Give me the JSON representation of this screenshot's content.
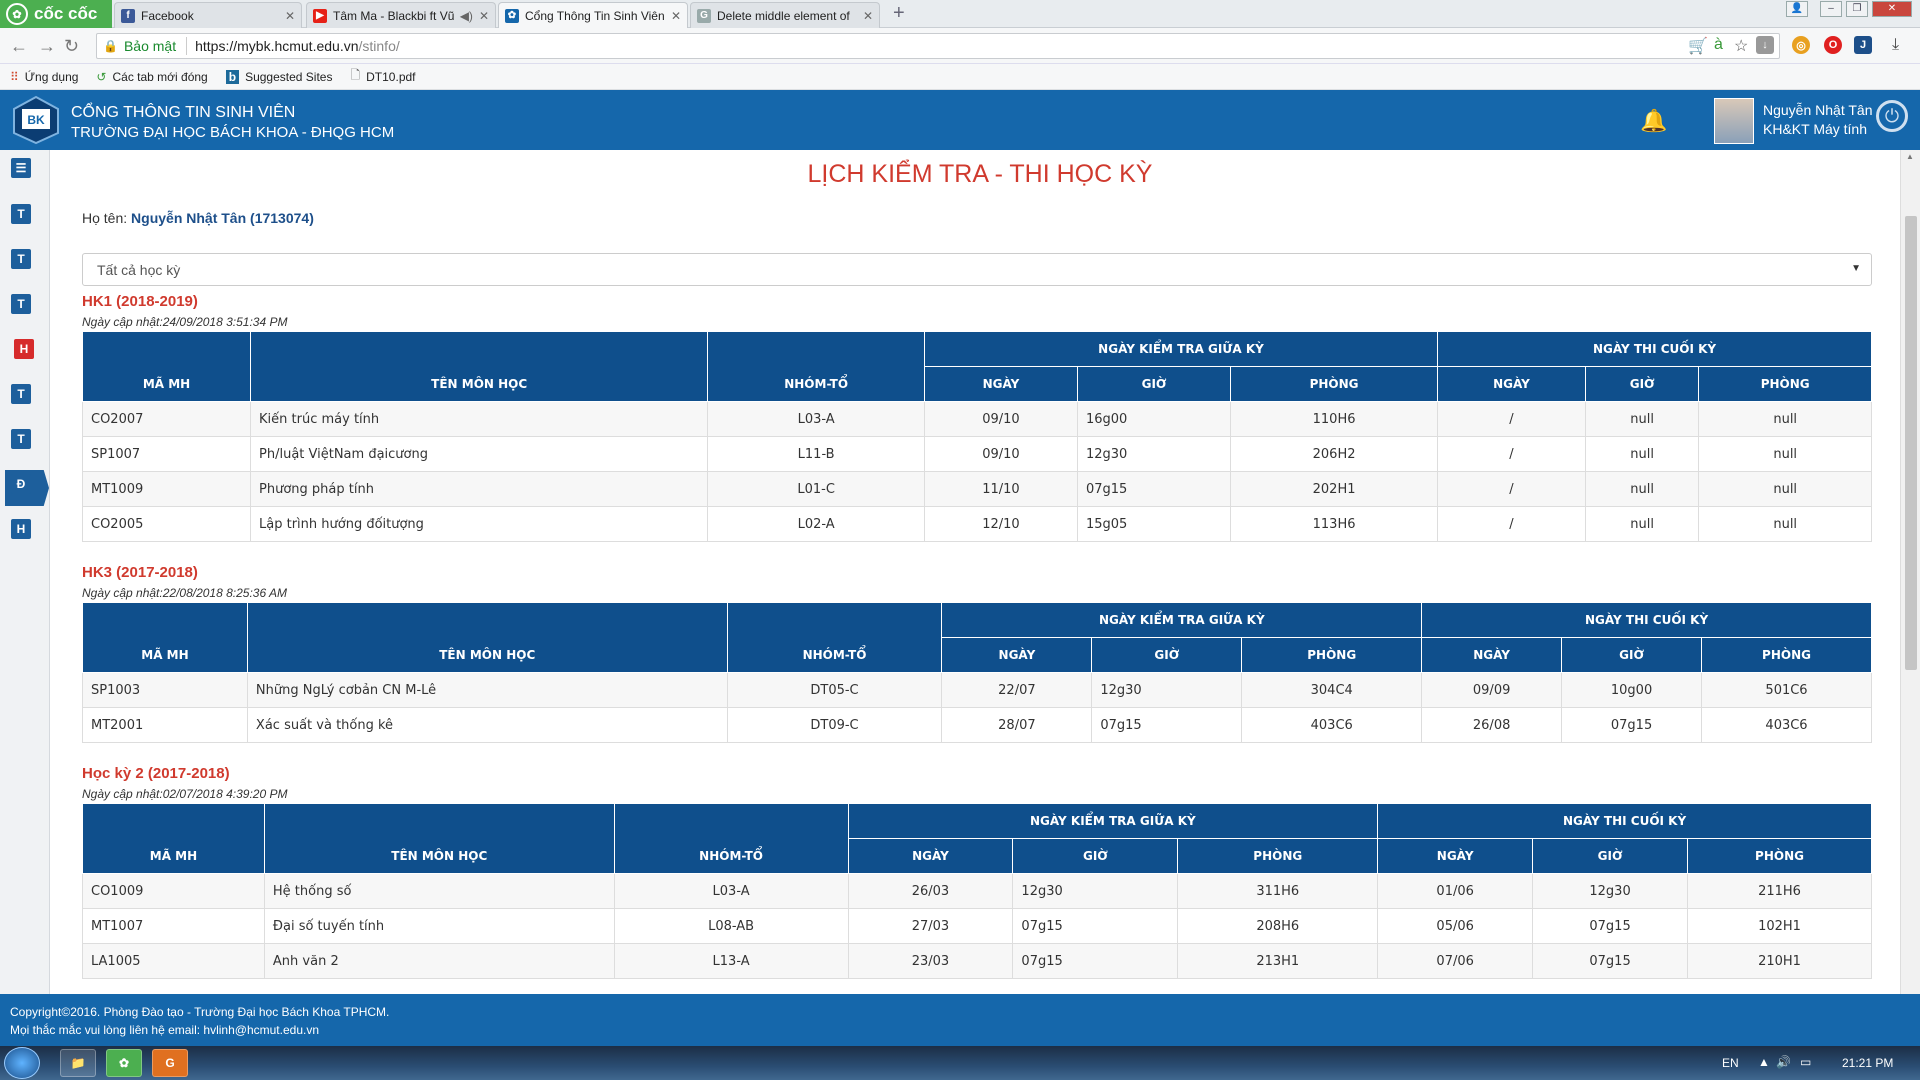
{
  "browser": {
    "brand": "cốc cốc",
    "tabs": [
      {
        "label": "Facebook",
        "icon": "facebook-icon",
        "color": "#3b5998",
        "glyph": "f"
      },
      {
        "label": "Tâm Ma - Blackbi ft Vũ",
        "icon": "youtube-icon",
        "color": "#e62117",
        "glyph": "▶"
      },
      {
        "label": "Cổng Thông Tin Sinh Viên",
        "icon": "bk-icon",
        "color": "#1567ab",
        "glyph": "✿"
      },
      {
        "label": "Delete middle element of",
        "icon": "page-icon",
        "color": "#9aa",
        "glyph": "G"
      }
    ],
    "secure_label": "Bảo mật",
    "url_host": "https://mybk.hcmut.edu.vn",
    "url_path": "/stinfo/",
    "bookmarks": [
      {
        "label": "Ứng dụng",
        "icon": "apps-grid-icon"
      },
      {
        "label": "Các tab mới đóng",
        "icon": "history-icon"
      },
      {
        "label": "Suggested Sites",
        "icon": "bing-icon"
      },
      {
        "label": "DT10.pdf",
        "icon": "file-icon"
      }
    ]
  },
  "header": {
    "title1": "CỔNG THÔNG TIN SINH VIÊN",
    "title2": "TRƯỜNG ĐẠI HỌC BÁCH KHOA - ĐHQG HCM",
    "logo_text": "BK",
    "user_name": "Nguyễn Nhật Tân",
    "user_major": "KH&KT Máy tính"
  },
  "sidebar": {
    "items": [
      "T",
      "T",
      "T",
      "H",
      "T",
      "T",
      "Đ",
      "H"
    ],
    "active_index": 3
  },
  "page": {
    "title": "LỊCH KIỂM TRA - THI HỌC KỲ",
    "student_label": "Họ tên:",
    "student_value": "Nguyễn Nhật Tân (1713074)",
    "semester_select": "Tất cả học kỳ"
  },
  "table_headers": {
    "code": "MÃ MH",
    "name": "TÊN MÔN HỌC",
    "group": "NHÓM-TỔ",
    "midterm": "NGÀY KIỂM TRA GIỮA KỲ",
    "final": "NGÀY THI CUỐI KỲ",
    "date": "NGÀY",
    "time": "GIỜ",
    "room": "PHÒNG"
  },
  "sections": [
    {
      "title": "HK1 (2018-2019)",
      "updated": "Ngày cập nhật:24/09/2018 3:51:34 PM",
      "rows": [
        [
          "CO2007",
          "Kiến trúc máy tính",
          "L03-A",
          "09/10",
          "16g00",
          "110H6",
          "/",
          "null",
          "null"
        ],
        [
          "SP1007",
          "Ph/luật ViệtNam đạicương",
          "L11-B",
          "09/10",
          "12g30",
          "206H2",
          "/",
          "null",
          "null"
        ],
        [
          "MT1009",
          "Phương pháp tính",
          "L01-C",
          "11/10",
          "07g15",
          "202H1",
          "/",
          "null",
          "null"
        ],
        [
          "CO2005",
          "Lập trình hướng đốitượng",
          "L02-A",
          "12/10",
          "15g05",
          "113H6",
          "/",
          "null",
          "null"
        ]
      ]
    },
    {
      "title": "HK3 (2017-2018)",
      "updated": "Ngày cập nhật:22/08/2018 8:25:36 AM",
      "rows": [
        [
          "SP1003",
          "Những NgLý cơbản CN M-Lê",
          "DT05-C",
          "22/07",
          "12g30",
          "304C4",
          "09/09",
          "10g00",
          "501C6"
        ],
        [
          "MT2001",
          "Xác suất và thống kê",
          "DT09-C",
          "28/07",
          "07g15",
          "403C6",
          "26/08",
          "07g15",
          "403C6"
        ]
      ]
    },
    {
      "title": "Học kỳ 2 (2017-2018)",
      "updated": "Ngày cập nhật:02/07/2018 4:39:20 PM",
      "rows": [
        [
          "CO1009",
          "Hệ thống số",
          "L03-A",
          "26/03",
          "12g30",
          "311H6",
          "01/06",
          "12g30",
          "211H6"
        ],
        [
          "MT1007",
          "Đại số tuyến tính",
          "L08-AB",
          "27/03",
          "07g15",
          "208H6",
          "05/06",
          "07g15",
          "102H1"
        ],
        [
          "LA1005",
          "Anh văn 2",
          "L13-A",
          "23/03",
          "07g15",
          "213H1",
          "07/06",
          "07g15",
          "210H1"
        ]
      ]
    }
  ],
  "footer": {
    "line1": "Copyright©2016. Phòng Đào tạo - Trường Đại học Bách Khoa TPHCM.",
    "line2": "Mọi thắc mắc vui lòng liên hệ email: hvlinh@hcmut.edu.vn"
  },
  "taskbar": {
    "lang": "EN",
    "time": "21:21 PM"
  },
  "colors": {
    "header_blue": "#1567ab",
    "table_header": "#0f4f8c",
    "title_red": "#d03a2e"
  }
}
